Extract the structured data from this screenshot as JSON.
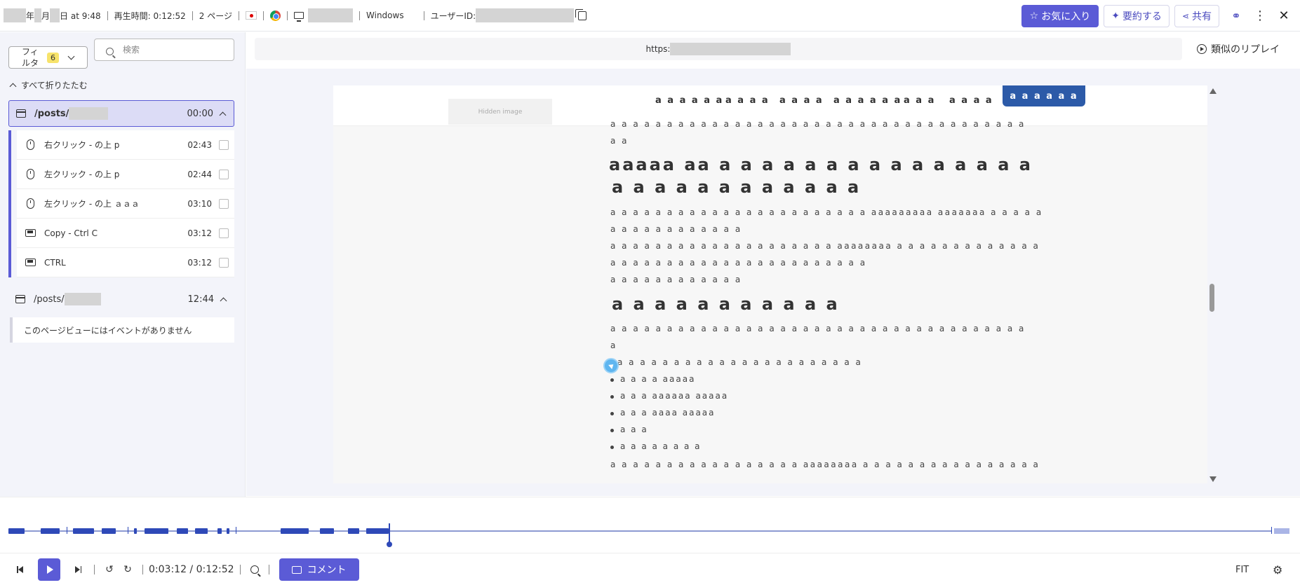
{
  "header": {
    "date_year_suffix": "年",
    "date_month_suffix": "月",
    "date_day_suffix": "日 at 9:48",
    "duration": "再生時間: 0:12:52",
    "pages": "2 ページ",
    "os": "Windows",
    "user_id_label": "ユーザーID:",
    "favorite_label": "お気に入り",
    "summarize_label": "要約する",
    "share_label": "共有"
  },
  "sidebar": {
    "filter_label": "フィルタ",
    "filter_count": "6",
    "search_placeholder": "検索",
    "collapse_all": "すべて折りたたむ",
    "pages": [
      {
        "path": "/posts/",
        "time": "00:00",
        "events": [
          {
            "icon": "mouse-icon",
            "label": "右クリック - の上 p",
            "time": "02:43"
          },
          {
            "icon": "mouse-icon",
            "label": "左クリック - の上 p",
            "time": "02:44"
          },
          {
            "icon": "mouse-icon",
            "label": "左クリック - の上 ａａａ",
            "time": "03:10"
          },
          {
            "icon": "keyboard-icon",
            "label": "Copy - Ctrl C",
            "time": "03:12"
          },
          {
            "icon": "keyboard-icon",
            "label": "CTRL",
            "time": "03:12"
          }
        ]
      },
      {
        "path": "/posts/",
        "time": "12:44",
        "empty_message": "このページビューにはイベントがありません"
      }
    ]
  },
  "main": {
    "url_prefix": "https:",
    "similar_replay": "類似のリプレイ",
    "page": {
      "hidden_image": "Hidden image",
      "nav": [
        "a a a a a a",
        "a a a a",
        "a a a a",
        "a a a a a a",
        "a a a",
        "a a a a",
        "a a a a a a"
      ],
      "lines": [
        "a a a a a a a a a a a a a a a a a a a a a a a a a a a a a a a a a a a a a",
        "a a",
        "aaaaa aa a a a a a a a a a a a a a a a",
        "a a a a a a a a a a a a",
        "a a a a a a a a a a a a a a a a a a a a a a a aaaaaaaaa aaaaaaa a a a a a",
        "a a a a a a a a a a a a",
        "a a a a a a a a a a a a a a a a a a a a aaaaaaaa a a a a a a a a a a a a a",
        "a a a a a a a a a a a a a a a a a a a a a a a",
        "a a a a a a a a a a a a",
        "a a a a a a a a a a a",
        "a a a a a a a a a a a a a a a a a a a a a a a a a a a a a a a a a a a a a",
        "a",
        "a a a a a a a a a a a a a a a a a a a a a a",
        "a a a a aaaaa",
        "a a a aaaaaa aaaaa",
        "a a a aaaa aaaaa",
        "a a a",
        "a a a a a a a a",
        "a a a a a a a a a a a a a a a a a aaaaaaaa a a a a a a a a a a a a a a a a"
      ]
    }
  },
  "player": {
    "time": "0:03:12 / 0:12:52",
    "comment_label": "コメント",
    "fit_label": "FIT",
    "progress": 0.247
  }
}
